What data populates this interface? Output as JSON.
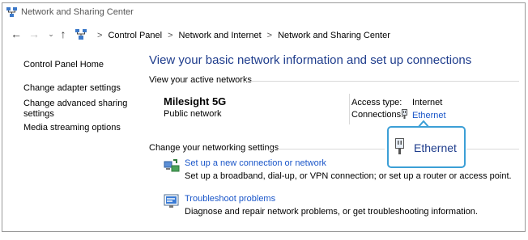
{
  "window": {
    "title": "Network and Sharing Center"
  },
  "address": {
    "crumbs": [
      "Control Panel",
      "Network and Internet",
      "Network and Sharing Center"
    ],
    "separator": ">"
  },
  "nav": {
    "back": "←",
    "forward": "→",
    "recent": "⌄",
    "up": "↑"
  },
  "sidebar": {
    "items": [
      {
        "label": "Control Panel Home"
      },
      {
        "label": "Change adapter settings"
      },
      {
        "label": "Change advanced sharing"
      },
      {
        "label": "settings"
      },
      {
        "label": "Media streaming options"
      }
    ]
  },
  "main": {
    "heading": "View your basic network information and set up connections",
    "active_section": "View your active networks",
    "network": {
      "name": "Milesight 5G",
      "category": "Public network",
      "access_label": "Access type:",
      "access_value": "Internet",
      "connections_label": "Connections:",
      "connection": "Ethernet"
    },
    "change_section": "Change your networking settings",
    "tasks": [
      {
        "link": "Set up a new connection or network",
        "desc": "Set up a broadband, dial-up, or VPN connection; or set up a router or access point.",
        "icon": "network-setup-icon"
      },
      {
        "link": "Troubleshoot problems",
        "desc": "Diagnose and repair network problems, or get troubleshooting information.",
        "icon": "troubleshoot-icon"
      }
    ]
  },
  "callout": {
    "label": "Ethernet",
    "border_color": "#3c9fd6"
  },
  "colors": {
    "heading": "#1e3c8c",
    "link": "#1a56c9"
  }
}
